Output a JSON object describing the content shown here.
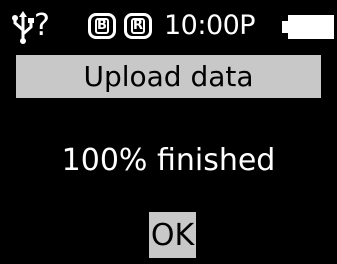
{
  "status_bar": {
    "usb_icon": "usb-icon",
    "usb_status": "?",
    "badge_b": "B",
    "badge_r": "R",
    "time": "10:00P",
    "battery_icon": "battery-full-icon"
  },
  "dialog": {
    "title": "Upload data",
    "message": "100% finished",
    "ok_label": "OK"
  },
  "colors": {
    "background": "#000000",
    "foreground": "#ffffff",
    "bar": "#c8c8c8",
    "bar_text": "#000000"
  }
}
